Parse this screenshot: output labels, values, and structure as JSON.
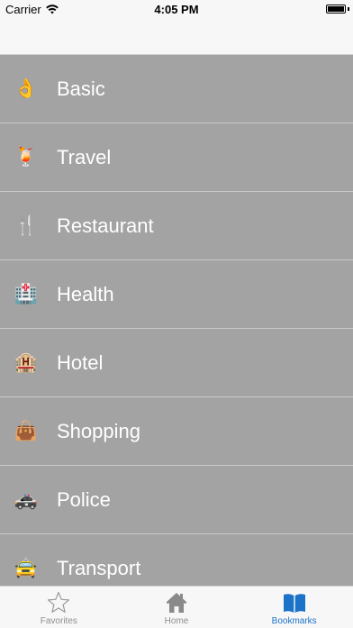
{
  "status_bar": {
    "carrier": "Carrier",
    "time": "4:05 PM"
  },
  "categories": [
    {
      "label": "Basic",
      "icon": "ok-hand-icon",
      "glyph": "👌"
    },
    {
      "label": "Travel",
      "icon": "tropical-drink-icon",
      "glyph": "🍹"
    },
    {
      "label": "Restaurant",
      "icon": "fork-knife-icon",
      "glyph": "🍴"
    },
    {
      "label": "Health",
      "icon": "hospital-icon",
      "glyph": "🏥"
    },
    {
      "label": "Hotel",
      "icon": "hotel-icon",
      "glyph": "🏨"
    },
    {
      "label": "Shopping",
      "icon": "handbag-icon",
      "glyph": "👜"
    },
    {
      "label": "Police",
      "icon": "police-car-icon",
      "glyph": "🚓"
    },
    {
      "label": "Transport",
      "icon": "taxi-icon",
      "glyph": "🚖"
    }
  ],
  "tab_bar": {
    "favorites": "Favorites",
    "home": "Home",
    "bookmarks": "Bookmarks",
    "active_color": "#1a73c8",
    "inactive_color": "#8e8e93"
  }
}
